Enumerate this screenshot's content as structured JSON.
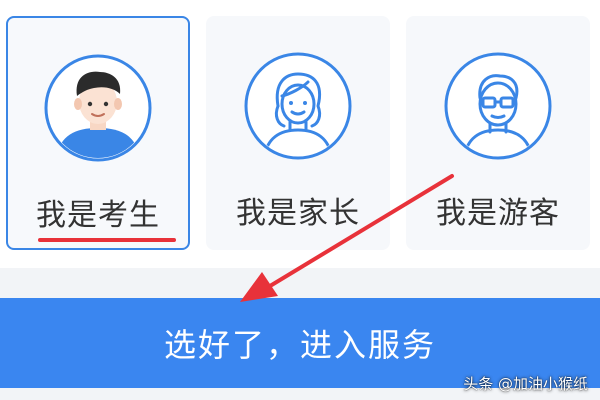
{
  "roles": [
    {
      "label": "我是考生",
      "selected": true,
      "icon": "student-avatar-icon"
    },
    {
      "label": "我是家长",
      "selected": false,
      "icon": "parent-avatar-icon"
    },
    {
      "label": "我是游客",
      "selected": false,
      "icon": "visitor-avatar-icon"
    }
  ],
  "action": {
    "enter_label": "选好了，进入服务"
  },
  "watermark": "头条 @加油小猴纸",
  "colors": {
    "accent": "#3a86f0",
    "selected_border": "#3a86e6",
    "underline": "#e8323a",
    "annotation_arrow": "#e8323a"
  }
}
